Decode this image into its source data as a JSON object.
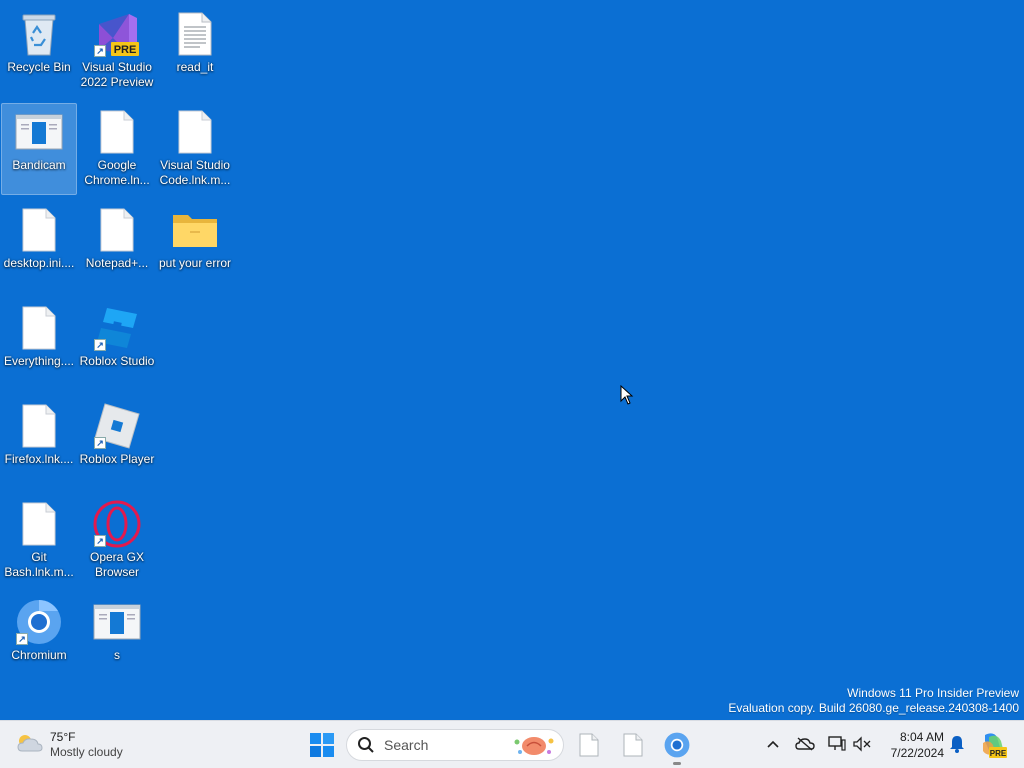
{
  "desktop": {
    "icons": [
      {
        "label": "Recycle Bin",
        "icon": "recycle-bin-icon",
        "shortcut": false
      },
      {
        "label": "Visual Studio 2022 Preview",
        "icon": "visual-studio-icon",
        "shortcut": true,
        "badge": "PRE"
      },
      {
        "label": "read_it",
        "icon": "text-file-icon",
        "shortcut": false
      },
      {
        "label": "Bandicam",
        "icon": "bandicam-icon",
        "shortcut": false,
        "selected": true
      },
      {
        "label": "Google Chrome.ln...",
        "icon": "blank-file-icon",
        "shortcut": false
      },
      {
        "label": "Visual Studio Code.lnk.m...",
        "icon": "blank-file-icon",
        "shortcut": false
      },
      {
        "label": "desktop.ini....",
        "icon": "blank-file-icon",
        "shortcut": false
      },
      {
        "label": "Notepad+...",
        "icon": "blank-file-icon",
        "shortcut": false
      },
      {
        "label": "put your error",
        "icon": "folder-icon",
        "shortcut": false
      },
      {
        "label": "Everything....",
        "icon": "blank-file-icon",
        "shortcut": false
      },
      {
        "label": "Roblox Studio",
        "icon": "roblox-studio-icon",
        "shortcut": true
      },
      {
        "label": "Firefox.lnk....",
        "icon": "blank-file-icon",
        "shortcut": false
      },
      {
        "label": "Roblox Player",
        "icon": "roblox-player-icon",
        "shortcut": true
      },
      {
        "label": "Git Bash.lnk.m...",
        "icon": "blank-file-icon",
        "shortcut": false
      },
      {
        "label": "Opera GX Browser",
        "icon": "opera-gx-icon",
        "shortcut": true
      },
      {
        "label": "Chromium",
        "icon": "chromium-icon",
        "shortcut": true
      },
      {
        "label": "s",
        "icon": "bandicam-icon",
        "shortcut": false
      }
    ],
    "watermark": {
      "line1": "Windows 11 Pro Insider Preview",
      "line2": "Evaluation copy. Build 26080.ge_release.240308-1400"
    }
  },
  "taskbar": {
    "weather": {
      "temp": "75°F",
      "condition": "Mostly cloudy",
      "icon": "cloudy-weather-icon"
    },
    "search": {
      "placeholder": "Search"
    },
    "apps": [
      {
        "name": "blank-file-app-1",
        "icon": "blank-file-icon"
      },
      {
        "name": "blank-file-app-2",
        "icon": "blank-file-icon"
      },
      {
        "name": "chromium-app",
        "icon": "chromium-icon",
        "running": true
      }
    ],
    "tray": {
      "icons": [
        "chevron-up-icon",
        "onedrive-offline-icon",
        "network-icon",
        "volume-muted-icon"
      ],
      "time": "8:04 AM",
      "date": "7/22/2024",
      "notification_icon": "bell-icon",
      "copilot_icon": "copilot-icon",
      "copilot_badge": "PRE"
    }
  },
  "colors": {
    "desktop": "#0b6fd3",
    "taskbar": "#eef0f4"
  }
}
